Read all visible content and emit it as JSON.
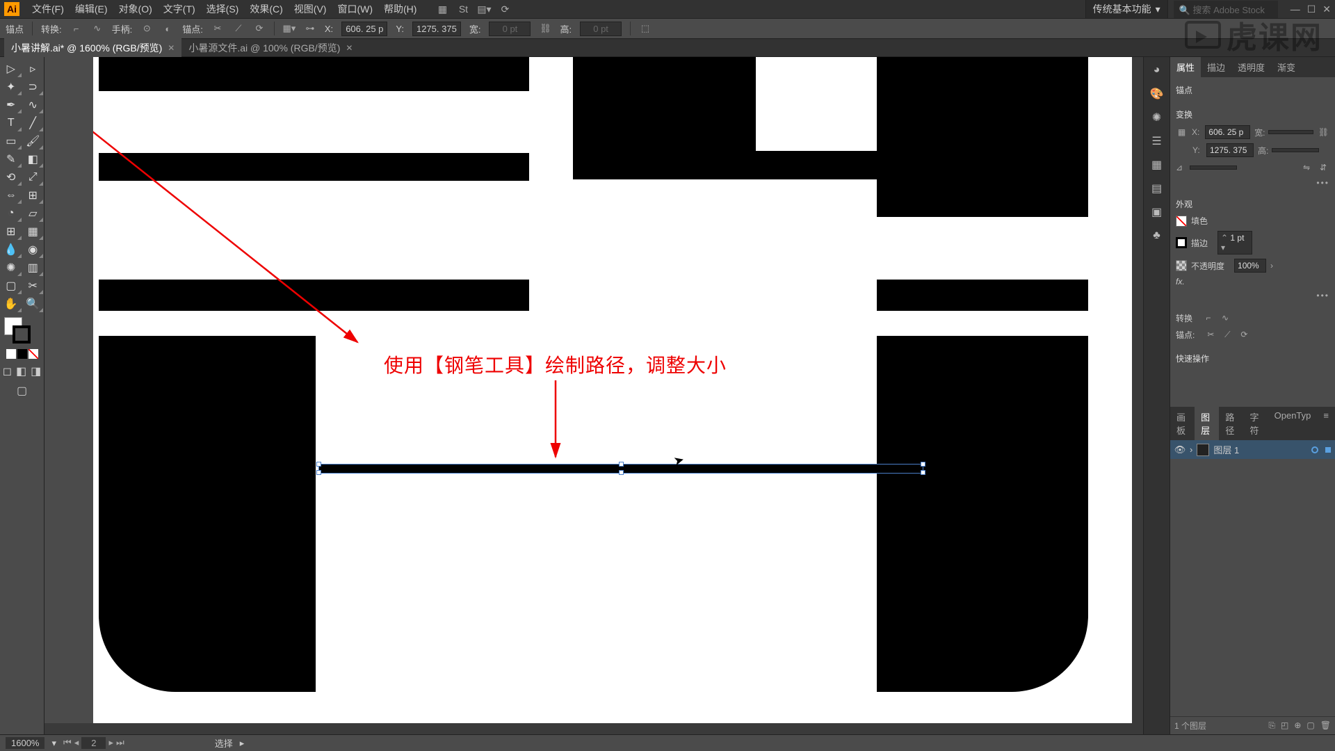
{
  "menubar": {
    "logo": "Ai",
    "items": [
      "文件(F)",
      "编辑(E)",
      "对象(O)",
      "文字(T)",
      "选择(S)",
      "效果(C)",
      "视图(V)",
      "窗口(W)",
      "帮助(H)"
    ],
    "workspace": "传统基本功能",
    "search_placeholder": "搜索 Adobe Stock"
  },
  "controlbar": {
    "anchor_label": "锚点",
    "convert_label": "转换:",
    "handle_label": "手柄:",
    "anchor2_label": "锚点:",
    "x_label": "X:",
    "y_label": "Y:",
    "x_val": "606. 25 p",
    "y_val": "1275. 375",
    "w_label": "宽:",
    "h_label": "高:",
    "w_val": "0 pt",
    "h_val": "0 pt"
  },
  "tabs": [
    {
      "label": "小暑讲解.ai* @ 1600% (RGB/预览)",
      "active": true
    },
    {
      "label": "小暑源文件.ai @ 100% (RGB/预览)",
      "active": false
    }
  ],
  "annotation": "使用【钢笔工具】绘制路径，调整大小",
  "properties": {
    "tabs": [
      "属性",
      "描边",
      "透明度",
      "渐变"
    ],
    "anchor_section": "锚点",
    "transform_section": "变换",
    "x_label": "X:",
    "y_label": "Y:",
    "x_val": "606. 25 p",
    "y_val": "1275. 375",
    "w_label": "宽:",
    "h_label": "高:",
    "appearance_section": "外观",
    "fill_label": "填色",
    "stroke_label": "描边",
    "stroke_val": "1 pt",
    "opacity_label": "不透明度",
    "opacity_val": "100%",
    "fx_label": "fx.",
    "convert_section": "转换",
    "anchor_edit_section": "锚点:",
    "quick_section": "快速操作"
  },
  "layers_panel": {
    "tabs": [
      "画板",
      "图层",
      "路径",
      "字符",
      "OpenTyp"
    ],
    "layer_name": "图层 1",
    "count_label": "1 个图层"
  },
  "statusbar": {
    "zoom": "1600%",
    "artboard_num": "2",
    "tool": "选择"
  },
  "watermark": "虎课网"
}
